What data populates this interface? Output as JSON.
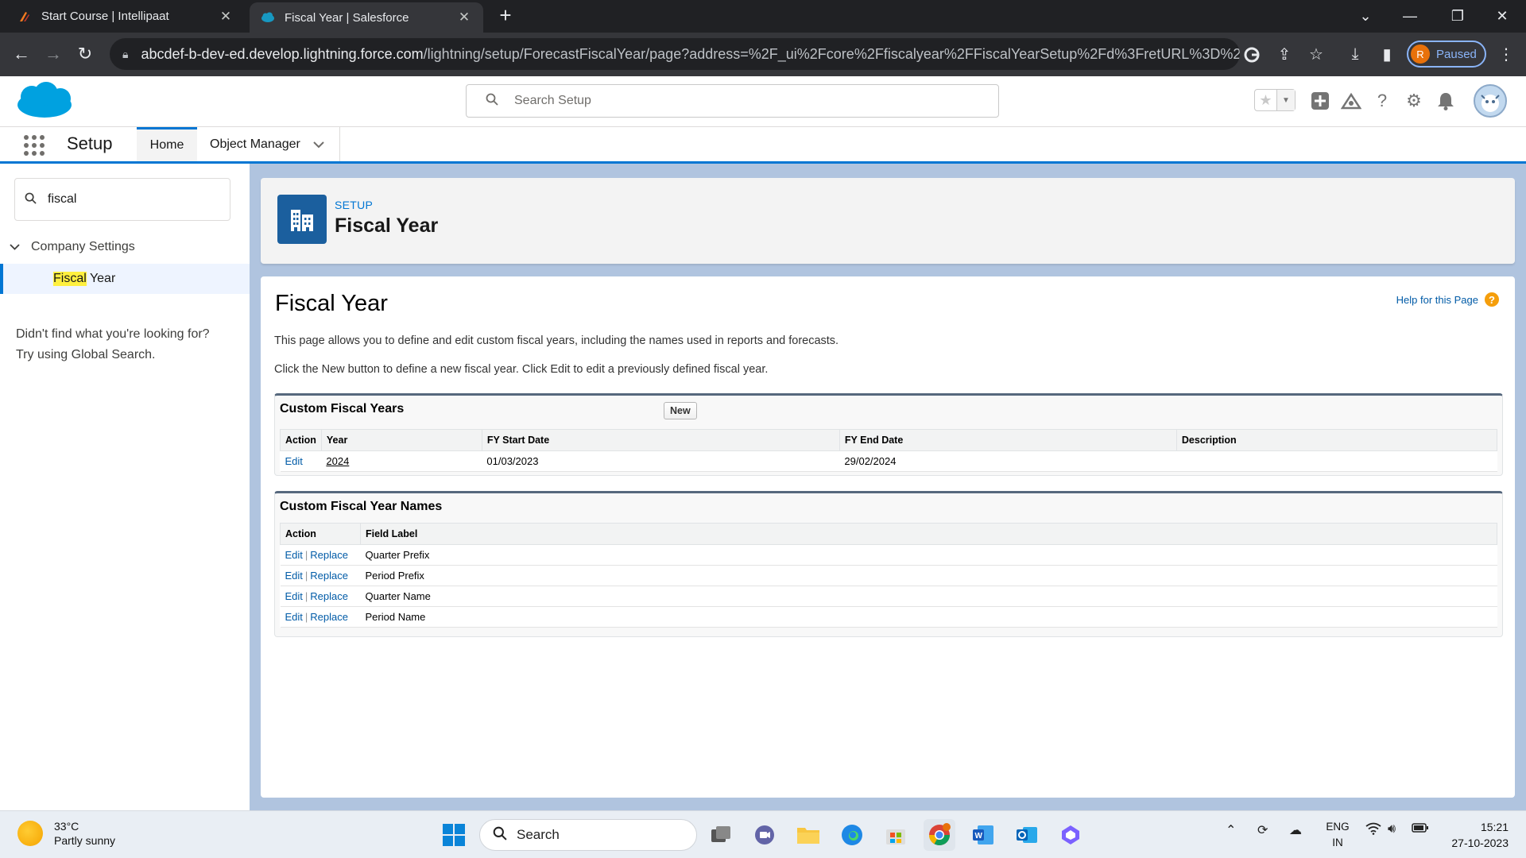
{
  "browser": {
    "tabs": [
      {
        "title": "Start Course | Intellipaat",
        "active": false
      },
      {
        "title": "Fiscal Year | Salesforce",
        "active": true
      }
    ],
    "url_host": "abcdef-b-dev-ed.develop.lightning.force.com",
    "url_path": "/lightning/setup/ForecastFiscalYear/page?address=%2F_ui%2Fcore%2Ffiscalyear%2FFiscalYearSetup%2Fd%3FretURL%3D%252Fset...",
    "profile_initial": "R",
    "profile_status": "Paused"
  },
  "header": {
    "search_placeholder": "Search Setup"
  },
  "context": {
    "app_title": "Setup",
    "tabs": [
      "Home",
      "Object Manager"
    ]
  },
  "sidebar": {
    "quickfind_value": "fiscal",
    "section": "Company Settings",
    "item_highlight": "Fiscal",
    "item_rest": " Year",
    "not_found_line1": "Didn't find what you're looking for?",
    "not_found_line2": "Try using Global Search."
  },
  "page_header": {
    "breadcrumb": "SETUP",
    "title": "Fiscal Year"
  },
  "main": {
    "title": "Fiscal Year",
    "help_link": "Help for this Page",
    "desc1": "This page allows you to define and edit custom fiscal years, including the names used in reports and forecasts.",
    "desc2": "Click the New button to define a new fiscal year. Click Edit to edit a previously defined fiscal year.",
    "custom_fiscal_years": {
      "title": "Custom Fiscal Years",
      "new_button": "New",
      "columns": [
        "Action",
        "Year",
        "FY Start Date",
        "FY End Date",
        "Description"
      ],
      "rows": [
        {
          "action": "Edit",
          "year": "2024",
          "start": "01/03/2023",
          "end": "29/02/2024",
          "description": ""
        }
      ]
    },
    "custom_fiscal_year_names": {
      "title": "Custom Fiscal Year Names",
      "columns": [
        "Action",
        "Field Label"
      ],
      "edit_label": "Edit",
      "replace_label": "Replace",
      "separator": "|",
      "rows": [
        "Quarter Prefix",
        "Period Prefix",
        "Quarter Name",
        "Period Name"
      ]
    }
  },
  "taskbar": {
    "temperature": "33°C",
    "weather": "Partly sunny",
    "search_label": "Search",
    "lang_line1": "ENG",
    "lang_line2": "IN",
    "time": "15:21",
    "date": "27-10-2023"
  },
  "colors": {
    "salesforce_blue": "#0176d3",
    "link_blue": "#015ba7",
    "setup_icon_bg": "#1b5f9e",
    "highlight_yellow": "#fff03f"
  }
}
